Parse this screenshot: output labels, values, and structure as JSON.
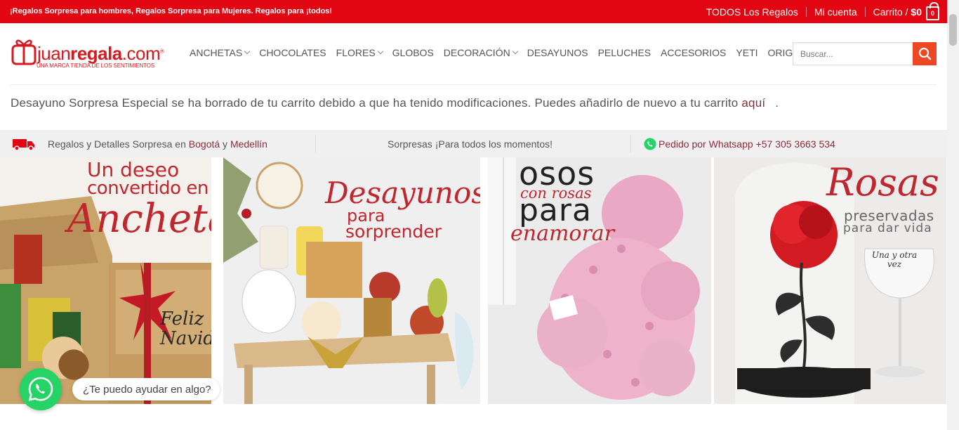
{
  "topbar": {
    "promo": "¡Regalos Sorpresa para hombres, Regalos Sorpresa para Mujeres. Regalos para ¡todos!",
    "all_gifts": "TODOS Los Regalos",
    "account": "Mi cuenta",
    "cart_label": "Carrito /",
    "cart_total": "$0",
    "cart_count": "0"
  },
  "logo": {
    "brand_light": "juan",
    "brand_bold": "regala",
    "brand_suffix": ".com",
    "trademark": "®",
    "tagline": "UNA MARCA TIENDA DE LOS SENTIMIENTOS"
  },
  "nav": {
    "items": [
      {
        "label": "ANCHETAS",
        "dropdown": true
      },
      {
        "label": "CHOCOLATES",
        "dropdown": false
      },
      {
        "label": "FLORES",
        "dropdown": true
      },
      {
        "label": "GLOBOS",
        "dropdown": false
      },
      {
        "label": "DECORACIÓN",
        "dropdown": true
      },
      {
        "label": "DESAYUNOS",
        "dropdown": false
      },
      {
        "label": "PELUCHES",
        "dropdown": false
      },
      {
        "label": "ACCESORIOS",
        "dropdown": false
      },
      {
        "label": "YETI",
        "dropdown": false
      },
      {
        "label": "ORIGINAL",
        "dropdown": true
      }
    ]
  },
  "search": {
    "placeholder": "Buscar...",
    "value": ""
  },
  "notice": {
    "text": "Desayuno Sorpresa Especial se ha borrado de tu carrito debido a que ha tenido modificaciones. Puedes añadirlo de nuevo a tu carrito",
    "link": "aquí",
    "end": "."
  },
  "infobar": {
    "delivery_prefix": "Regalos y Detalles Sorpresa en",
    "city1": "Bogotá",
    "conj": "y",
    "city2": "Medellín",
    "middle": "Sorpresas ¡Para todos los momentos!",
    "whatsapp": "Pedido por Whatsapp +57 305 3663 534"
  },
  "banners": {
    "b1": {
      "line1": "Un deseo",
      "line2": "convertido en",
      "line3": "Ancheta",
      "card": "Feliz Navidad"
    },
    "b2": {
      "line1": "Desayunos",
      "line2": "para",
      "line3": "sorprender"
    },
    "b3": {
      "line1": "osos",
      "line2": "con rosas",
      "line3": "para",
      "line4": "enamorar"
    },
    "b4": {
      "line1": "Rosas",
      "line2": "preservadas",
      "line3": "para dar vida",
      "glass": "Una y otra vez"
    }
  },
  "chat": {
    "tooltip": "¿Te puedo ayudar en algo?"
  },
  "colors": {
    "brand_red": "#e20613",
    "search_button": "#ee4723",
    "whatsapp_green": "#25d366",
    "link": "#8b2d3a"
  }
}
